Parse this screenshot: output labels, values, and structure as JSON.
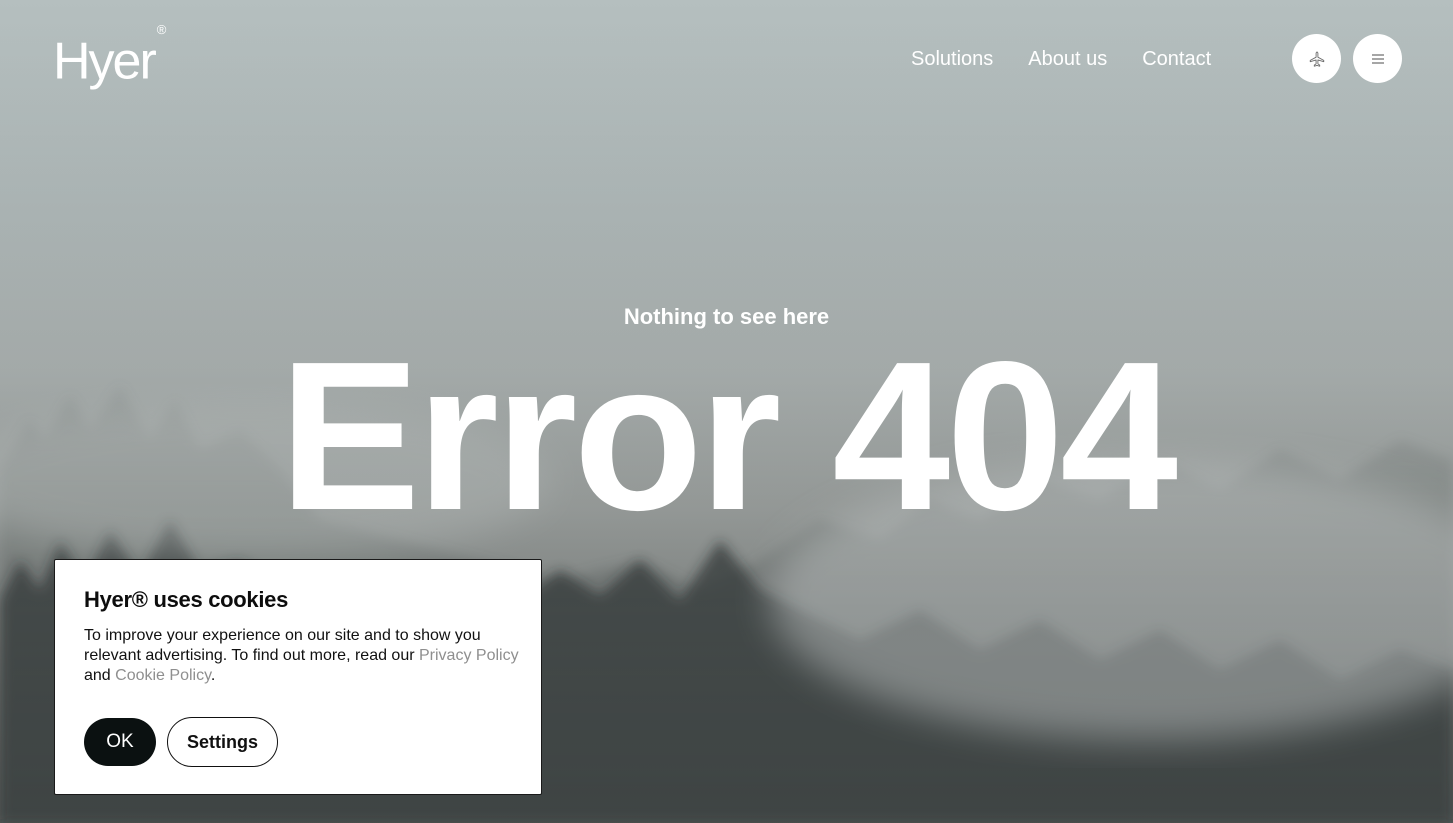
{
  "brand": {
    "name": "Hyer",
    "mark": "®"
  },
  "nav": {
    "items": [
      {
        "label": "Solutions"
      },
      {
        "label": "About us"
      },
      {
        "label": "Contact"
      }
    ],
    "icons": {
      "flight": "airplane-icon",
      "menu": "hamburger-menu-icon"
    }
  },
  "hero": {
    "subtitle": "Nothing to see here",
    "title": "Error 404"
  },
  "cookie_banner": {
    "title": "Hyer® uses cookies",
    "text_before": "To improve your experience on our site and to show you relevant advertising. To find out more, read our ",
    "privacy_link": "Privacy Policy",
    "text_and": " and ",
    "cookie_link": "Cookie Policy",
    "text_end": ".",
    "ok_label": "OK",
    "settings_label": "Settings"
  },
  "colors": {
    "text_on_image": "#ffffff",
    "banner_bg": "#ffffff",
    "ok_button_bg": "#0b1111",
    "link_gray": "#8f8f8f"
  }
}
